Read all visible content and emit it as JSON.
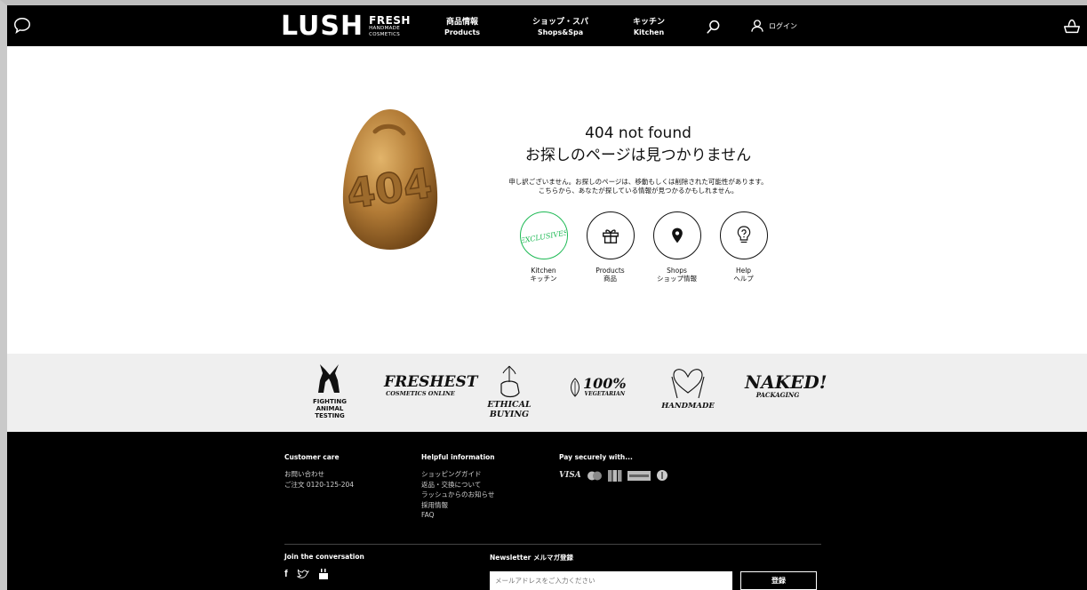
{
  "header": {
    "logo_main": "LUSH",
    "logo_fresh": "FRESH",
    "logo_line1": "HANDMADE",
    "logo_line2": "COSMETICS",
    "nav": [
      {
        "jp": "商品情報",
        "en": "Products"
      },
      {
        "jp": "ショップ・スパ",
        "en": "Shops&Spa"
      },
      {
        "jp": "キッチン",
        "en": "Kitchen"
      }
    ],
    "login_label": "ログイン",
    "icons": {
      "chat": "chat-bubble-icon",
      "search": "search-icon",
      "user": "user-icon",
      "cart": "basket-icon"
    }
  },
  "main": {
    "egg_text": "404",
    "title_line1": "404 not found",
    "title_line2": "お探しのページは見つかりません",
    "message_line1": "申し訳ございません。お探しのページは、移動もしくは削除された可能性があります。",
    "message_line2": "こちらから、あなたが探している情報が見つかるかもしれません。",
    "links": [
      {
        "en": "Kitchen",
        "jp": "キッチン",
        "badge": "EXCLUSIVES",
        "icon": "exclusives-badge-icon",
        "color": "#1db954"
      },
      {
        "en": "Products",
        "jp": "商品",
        "icon": "gift-icon"
      },
      {
        "en": "Shops",
        "jp": "ショップ情報",
        "icon": "map-pin-icon"
      },
      {
        "en": "Help",
        "jp": "ヘルプ",
        "icon": "question-bulb-icon"
      }
    ]
  },
  "values": {
    "fighting_line1": "FIGHTING",
    "fighting_line2": "ANIMAL",
    "fighting_line3": "TESTING",
    "freshest_line1": "FRESHEST",
    "freshest_line2": "COSMETICS ONLINE",
    "ethical": "ETHICAL BUYING",
    "vegetarian_line1": "100%",
    "vegetarian_line2": "VEGETARIAN",
    "handmade": "HANDMADE",
    "naked_line1": "NAKED!",
    "naked_line2": "PACKAGING"
  },
  "footer": {
    "customer_care": {
      "heading": "Customer care",
      "links": [
        "お問い合わせ",
        "ご注文 0120-125-204"
      ]
    },
    "helpful": {
      "heading": "Helpful information",
      "links": [
        "ショッピングガイド",
        "返品・交換について",
        "ラッシュからのお知らせ",
        "採用情報",
        "FAQ"
      ]
    },
    "pay": {
      "heading": "Pay securely with...",
      "visa": "VISA",
      "amex": "AMERICAN EXPRESS",
      "jcb": "JCB"
    },
    "join": {
      "heading": "Join the conversation",
      "facebook": "f"
    },
    "newsletter": {
      "heading": "Newsletter メルマガ登録",
      "placeholder": "メールアドレスをご入力ください",
      "button": "登録"
    }
  }
}
